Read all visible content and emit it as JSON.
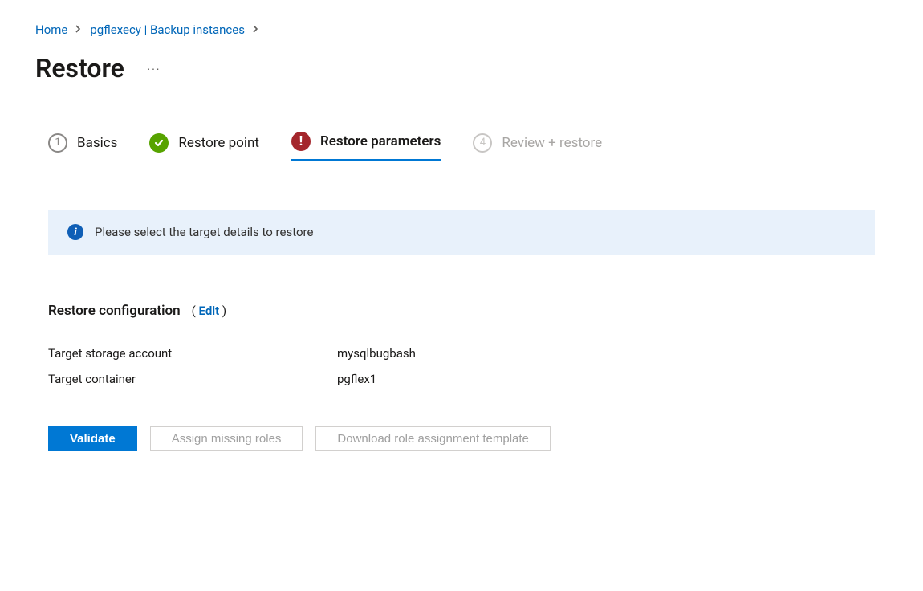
{
  "breadcrumb": {
    "home": "Home",
    "parent": "pgflexecy | Backup instances"
  },
  "page_title": "Restore",
  "stepper": {
    "step1": {
      "num": "1",
      "label": "Basics"
    },
    "step2": {
      "label": "Restore point"
    },
    "step3": {
      "label": "Restore parameters"
    },
    "step4": {
      "num": "4",
      "label": "Review + restore"
    }
  },
  "info_text": "Please select the target details to restore",
  "config": {
    "header": "Restore configuration",
    "edit_label": "Edit",
    "rows": {
      "target_storage_label": "Target storage account",
      "target_storage_value": "mysqlbugbash",
      "target_container_label": "Target container",
      "target_container_value": "pgflex1"
    }
  },
  "buttons": {
    "validate": "Validate",
    "assign_roles": "Assign missing roles",
    "download_template": "Download role assignment template"
  }
}
